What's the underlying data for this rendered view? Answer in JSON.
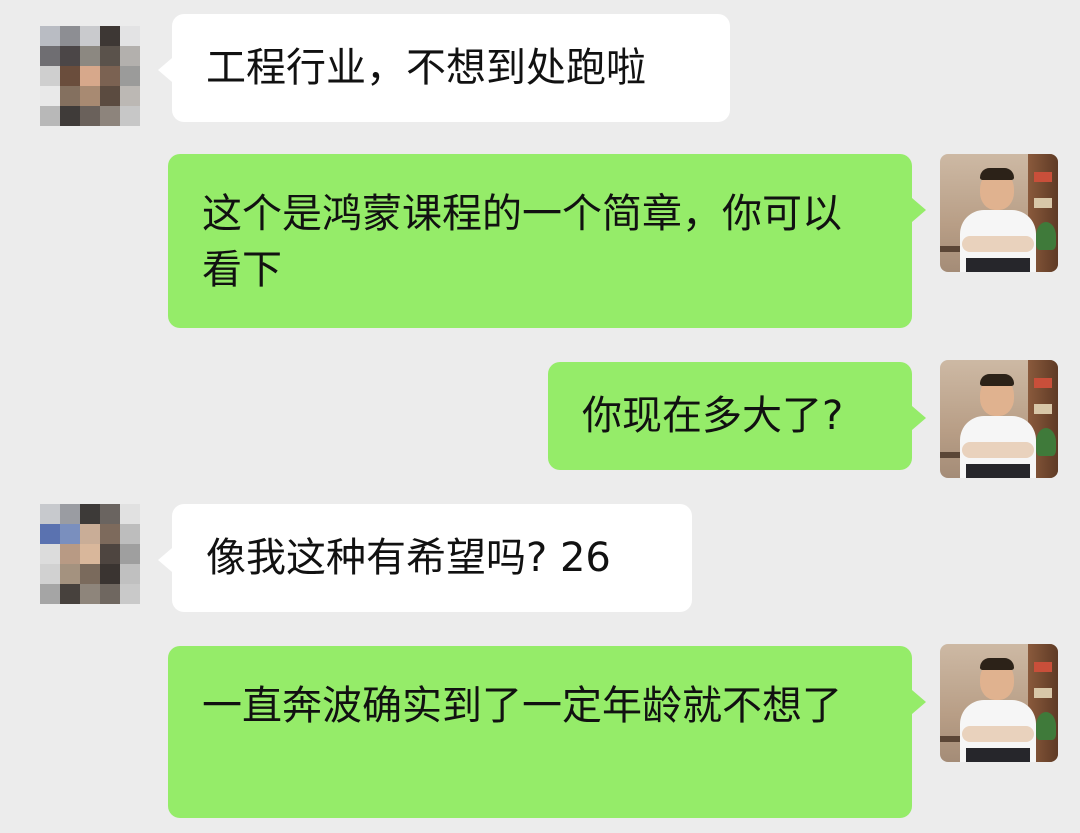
{
  "messages": [
    {
      "side": "in",
      "text": "工程行业，不想到处跑啦"
    },
    {
      "side": "out",
      "text": "这个是鸿蒙课程的一个简章，你可以看下"
    },
    {
      "side": "out",
      "text": "你现在多大了?"
    },
    {
      "side": "in",
      "text": "像我这种有希望吗? 26"
    },
    {
      "side": "out",
      "text": "一直奔波确实到了一定年龄就不想了"
    }
  ],
  "colors": {
    "background": "#ececec",
    "incoming_bubble": "#ffffff",
    "outgoing_bubble": "#95ec69",
    "text": "#111111"
  },
  "avatars": {
    "contact": "pixelated-avatar",
    "self": "person-photo-avatar"
  }
}
